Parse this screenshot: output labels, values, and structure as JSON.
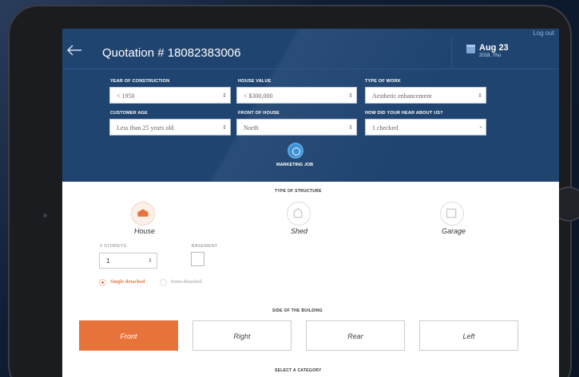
{
  "header": {
    "logout_label": "Log out",
    "title": "Quotation # 18082383006",
    "date_main": "Aug 23",
    "date_sub": "2018, Thu"
  },
  "form": {
    "year_label": "YEAR OF CONSTRUCTION",
    "year_value": "< 1950",
    "house_value_label": "HOUSE VALUE",
    "house_value_value": "< $300,000",
    "work_type_label": "TYPE OF WORK",
    "work_type_value": "Aesthetic enhancement",
    "customer_age_label": "CUSTOMER AGE",
    "customer_age_value": "Less than 25 years old",
    "front_label": "FRONT OF HOUSE",
    "front_value": "North",
    "hear_label": "HOW DID YOUR HEAR ABOUT US?",
    "hear_value": "1 checked"
  },
  "marketing": {
    "label": "MARKETING JOB"
  },
  "structure": {
    "section_title": "TYPE OF STRUCTURE",
    "items": [
      {
        "label": "House",
        "icon": "house-icon"
      },
      {
        "label": "Shed",
        "icon": "shed-icon"
      },
      {
        "label": "Garage",
        "icon": "garage-icon"
      }
    ],
    "storeys_label": "# STOREYS",
    "storeys_value": "1",
    "basement_label": "BASEMENT",
    "detach_options": [
      "Single detached",
      "Semi-detached"
    ]
  },
  "side": {
    "section_title": "SIDE OF THE BUILDING",
    "buttons": [
      "Front",
      "Right",
      "Rear",
      "Left"
    ]
  },
  "category": {
    "section_title": "SELECT A CATEGORY"
  },
  "colors": {
    "accent": "#e8733a",
    "header_bg": "#1f4470"
  }
}
